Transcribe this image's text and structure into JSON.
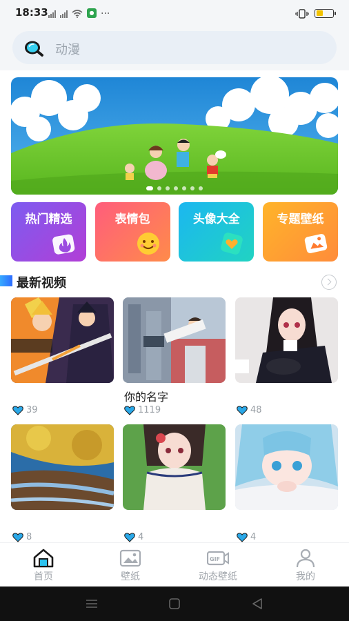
{
  "status_bar": {
    "time": "18:33",
    "more": "···"
  },
  "search": {
    "placeholder": "动漫"
  },
  "banner": {
    "slide_count": 7,
    "active_index": 0
  },
  "categories": [
    {
      "label": "热门精选",
      "icon": "flame-icon"
    },
    {
      "label": "表情包",
      "icon": "smiley-icon"
    },
    {
      "label": "头像大全",
      "icon": "heart-card-icon"
    },
    {
      "label": "专题壁纸",
      "icon": "photo-card-icon"
    }
  ],
  "section": {
    "title": "最新视频"
  },
  "videos": [
    {
      "title": "",
      "likes": "39"
    },
    {
      "title": "你的名字",
      "likes": "1119"
    },
    {
      "title": "",
      "likes": "48"
    },
    {
      "title": "",
      "likes": "8"
    },
    {
      "title": "",
      "likes": "4"
    },
    {
      "title": "",
      "likes": "4"
    }
  ],
  "bottom_nav": [
    {
      "label": "首页",
      "icon": "home-icon",
      "active": true
    },
    {
      "label": "壁纸",
      "icon": "image-icon",
      "active": false
    },
    {
      "label": "动态壁纸",
      "icon": "gif-icon",
      "active": false
    },
    {
      "label": "我的",
      "icon": "person-icon",
      "active": false
    }
  ],
  "colors": {
    "accent_blue": "#2d6cff",
    "heart_blue": "#2aa8e8",
    "home_icon_blue": "#2ec4f0"
  }
}
